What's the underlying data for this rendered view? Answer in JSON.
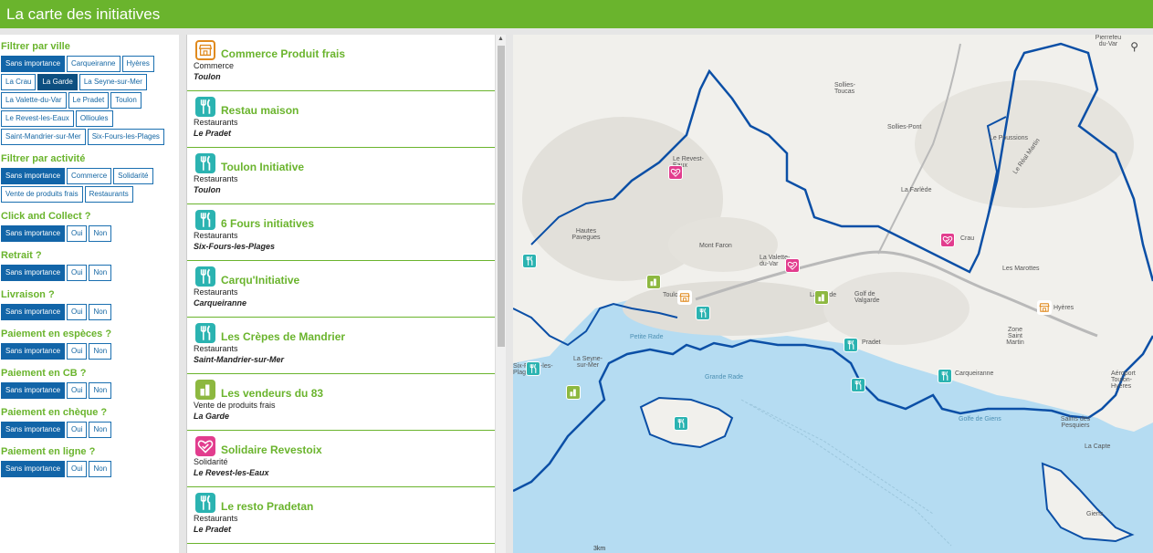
{
  "header": {
    "title": "La carte des initiatives"
  },
  "filters": {
    "city": {
      "title": "Filtrer par ville",
      "options": [
        "Sans importance",
        "Carqueiranne",
        "Hyères",
        "La Crau",
        "La Garde",
        "La Seyne-sur-Mer",
        "La Valette-du-Var",
        "Le Pradet",
        "Toulon",
        "Le Revest-les-Eaux",
        "Ollioules",
        "Saint-Mandrier-sur-Mer",
        "Six-Fours-les-Plages"
      ]
    },
    "activity": {
      "title": "Filtrer par activité",
      "options": [
        "Sans importance",
        "Commerce",
        "Solidarité",
        "Vente de produits frais",
        "Restaurants"
      ]
    },
    "yesno": [
      {
        "title": "Click and Collect ?",
        "options": [
          "Sans importance",
          "Oui",
          "Non"
        ]
      },
      {
        "title": "Retrait ?",
        "options": [
          "Sans importance",
          "Oui",
          "Non"
        ]
      },
      {
        "title": "Livraison ?",
        "options": [
          "Sans importance",
          "Oui",
          "Non"
        ]
      },
      {
        "title": "Paiement en espèces ?",
        "options": [
          "Sans importance",
          "Oui",
          "Non"
        ]
      },
      {
        "title": "Paiement en CB ?",
        "options": [
          "Sans importance",
          "Oui",
          "Non"
        ]
      },
      {
        "title": "Paiement en chèque ?",
        "options": [
          "Sans importance",
          "Oui",
          "Non"
        ]
      },
      {
        "title": "Paiement en ligne ?",
        "options": [
          "Sans importance",
          "Oui",
          "Non"
        ]
      }
    ]
  },
  "list": [
    {
      "name": "Commerce Produit frais",
      "category": "Commerce",
      "city": "Toulon",
      "icon": "shop-icon"
    },
    {
      "name": "Restau maison",
      "category": "Restaurants",
      "city": "Le Pradet",
      "icon": "restaurant-icon"
    },
    {
      "name": "Toulon Initiative",
      "category": "Restaurants",
      "city": "Toulon",
      "icon": "restaurant-icon"
    },
    {
      "name": "6 Fours initiatives",
      "category": "Restaurants",
      "city": "Six-Fours-les-Plages",
      "icon": "restaurant-icon"
    },
    {
      "name": "Carqu'Initiative",
      "category": "Restaurants",
      "city": "Carqueiranne",
      "icon": "restaurant-icon"
    },
    {
      "name": "Les Crèpes de Mandrier",
      "category": "Restaurants",
      "city": "Saint-Mandrier-sur-Mer",
      "icon": "restaurant-icon"
    },
    {
      "name": "Les vendeurs du 83",
      "category": "Vente de produits frais",
      "city": "La Garde",
      "icon": "produce-icon"
    },
    {
      "name": "Solidaire Revestoix",
      "category": "Solidarité",
      "city": "Le Revest-les-Eaux",
      "icon": "solidarity-icon"
    },
    {
      "name": "Le resto Pradetan",
      "category": "Restaurants",
      "city": "Le Pradet",
      "icon": "restaurant-icon"
    }
  ],
  "map": {
    "labels": {
      "pierrefeu": "Pierrefeu du-Var",
      "solliesToucas": "Sollies-Toucas",
      "solliesPont": "Sollies-Pont",
      "revest": "Le Revest-Eaux",
      "farlede": "La Farlède",
      "crau": "Crau",
      "montFaron": "Mont Faron",
      "valette": "La Valette-du-Var",
      "toulon": "Toulon",
      "laGarde": "La Garde",
      "hyeres": "Hyères",
      "pradet": "Pradet",
      "carqueiranne": "Carqueiranne",
      "laSeyne": "La Seyne-sur-Mer",
      "petiteRade": "Petite Rade",
      "grandeRade": "Grande Rade",
      "golfeGiens": "Golfe de Giens",
      "giens": "Giens",
      "capte": "La Capte",
      "salins": "Salins des Pesquiers",
      "aeroport": "Aéroport Toulon-Hyères",
      "marottes": "Les Marottes",
      "zoneSaintMartin": "Zone Saint Martin",
      "sixFours": "Six-Fours-les-Plages",
      "hautesPavegues": "Hautes Pavegues",
      "golfValgarde": "Golf de Valgarde",
      "poussions": "Le Poussions",
      "realMartin": "Le Réal Martin"
    },
    "scale": "3km"
  },
  "colors": {
    "header": "#6ab42d",
    "filterActive": "#1265a8",
    "restaurant": "#2bb3b1",
    "solidarity": "#e23d8e",
    "produce": "#8db840",
    "shop": "#e08a1e",
    "sea": "#b5dcf2",
    "border": "#0b4fa6"
  }
}
